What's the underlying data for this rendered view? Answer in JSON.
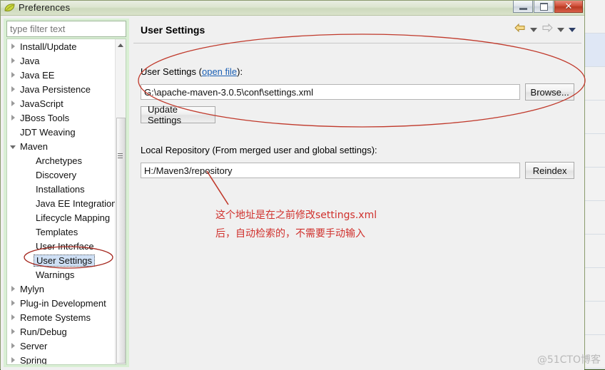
{
  "window": {
    "title": "Preferences",
    "icon": "leaf-icon",
    "buttons": {
      "minimize": "minimize-button",
      "maximize": "maximize-button",
      "close_label": "✕"
    }
  },
  "sidebar": {
    "filter": {
      "value": "",
      "placeholder": "type filter text"
    },
    "items": [
      {
        "label": "Install/Update",
        "level": 1,
        "state": "collapsed",
        "selected": false
      },
      {
        "label": "Java",
        "level": 1,
        "state": "collapsed",
        "selected": false
      },
      {
        "label": "Java EE",
        "level": 1,
        "state": "collapsed",
        "selected": false
      },
      {
        "label": "Java Persistence",
        "level": 1,
        "state": "collapsed",
        "selected": false
      },
      {
        "label": "JavaScript",
        "level": 1,
        "state": "collapsed",
        "selected": false
      },
      {
        "label": "JBoss Tools",
        "level": 1,
        "state": "collapsed",
        "selected": false
      },
      {
        "label": "JDT Weaving",
        "level": 1,
        "state": "leaf",
        "selected": false
      },
      {
        "label": "Maven",
        "level": 1,
        "state": "expanded",
        "selected": false
      },
      {
        "label": "Archetypes",
        "level": 2,
        "state": "leaf",
        "selected": false
      },
      {
        "label": "Discovery",
        "level": 2,
        "state": "leaf",
        "selected": false
      },
      {
        "label": "Installations",
        "level": 2,
        "state": "leaf",
        "selected": false
      },
      {
        "label": "Java EE Integration",
        "level": 2,
        "state": "leaf",
        "selected": false
      },
      {
        "label": "Lifecycle Mapping",
        "level": 2,
        "state": "leaf",
        "selected": false
      },
      {
        "label": "Templates",
        "level": 2,
        "state": "leaf",
        "selected": false
      },
      {
        "label": "User Interface",
        "level": 2,
        "state": "leaf",
        "selected": false
      },
      {
        "label": "User Settings",
        "level": 2,
        "state": "leaf",
        "selected": true
      },
      {
        "label": "Warnings",
        "level": 2,
        "state": "leaf",
        "selected": false
      },
      {
        "label": "Mylyn",
        "level": 1,
        "state": "collapsed",
        "selected": false
      },
      {
        "label": "Plug-in Development",
        "level": 1,
        "state": "collapsed",
        "selected": false
      },
      {
        "label": "Remote Systems",
        "level": 1,
        "state": "collapsed",
        "selected": false
      },
      {
        "label": "Run/Debug",
        "level": 1,
        "state": "collapsed",
        "selected": false
      },
      {
        "label": "Server",
        "level": 1,
        "state": "collapsed",
        "selected": false
      },
      {
        "label": "Spring",
        "level": 1,
        "state": "collapsed",
        "selected": false
      }
    ]
  },
  "page": {
    "title": "User Settings",
    "nav": {
      "back_icon": "back-arrow-icon",
      "forward_icon": "forward-arrow-icon",
      "menu_icon": "chevron-down-icon"
    },
    "user_settings": {
      "label_prefix": "User Settings (",
      "link": "open file",
      "label_suffix": "):",
      "path_value": "G:\\apache-maven-3.0.5\\conf\\settings.xml",
      "browse_label": "Browse...",
      "update_label": "Update Settings"
    },
    "local_repository": {
      "label": "Local Repository (From merged user and global settings):",
      "path_value": "H:/Maven3/repository",
      "reindex_label": "Reindex"
    }
  },
  "annotations": {
    "note_line1": "这个地址是在之前修改settings.xml",
    "note_line2": "后，自动检索的，不需要手动输入",
    "ink_color": "#c0392b",
    "watermark": "@51CTO博客"
  }
}
